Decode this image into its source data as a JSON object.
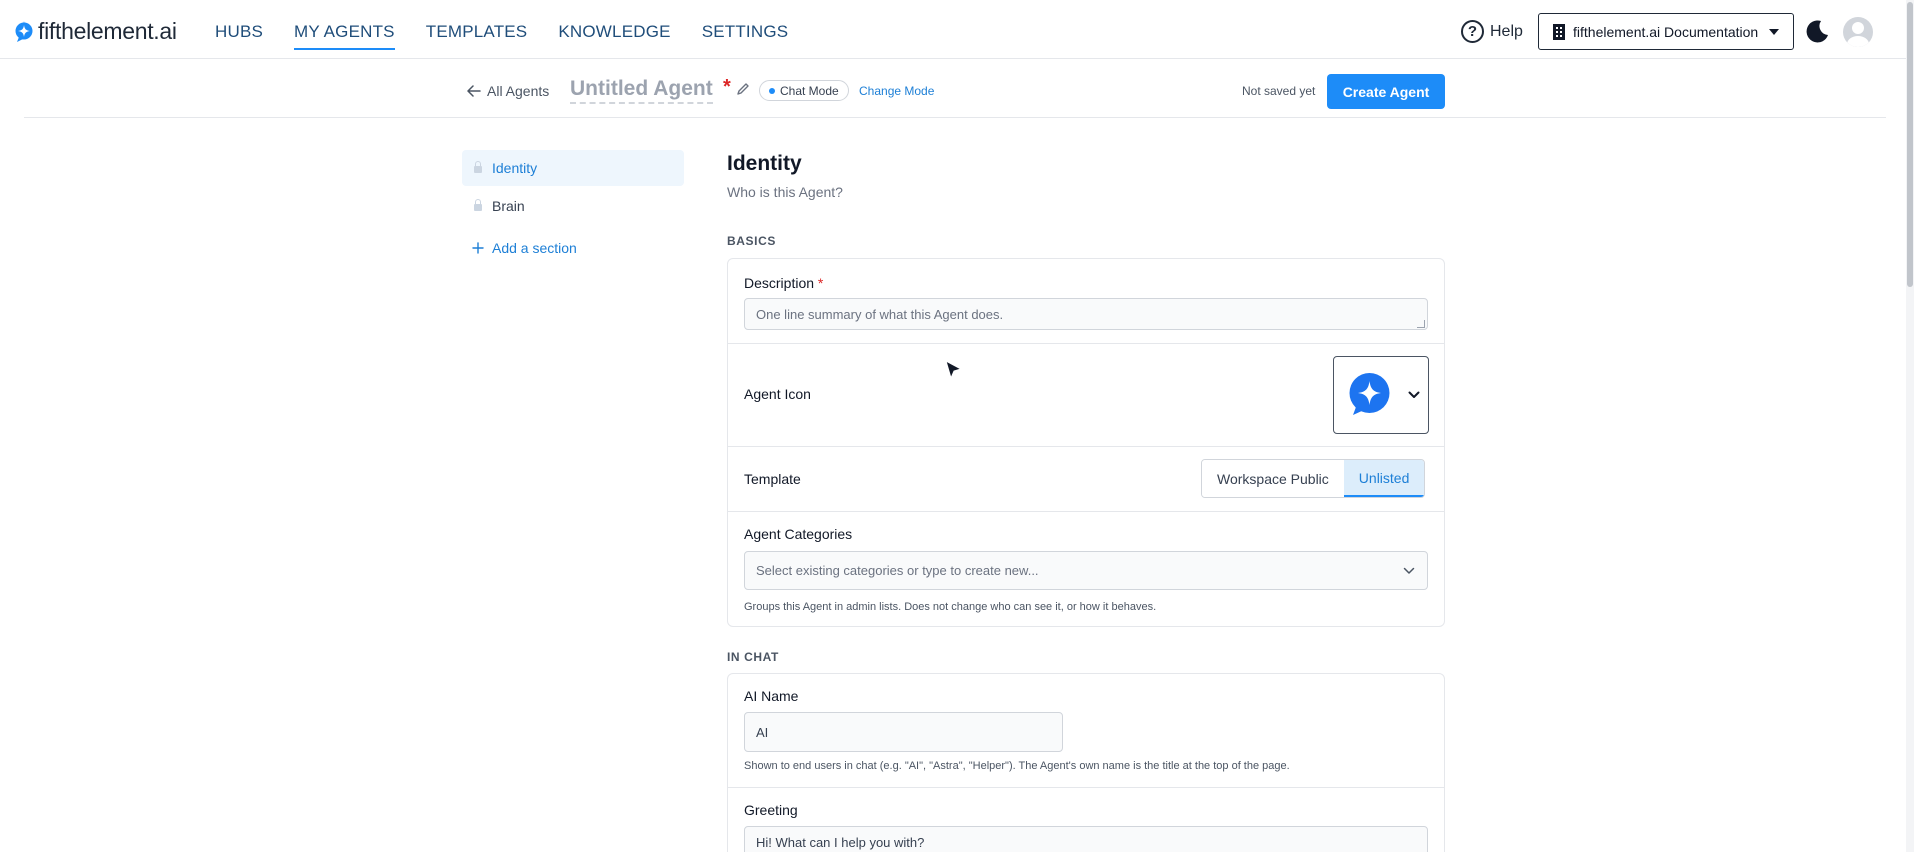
{
  "brand": {
    "name": "fifthelement.ai"
  },
  "nav": {
    "links": [
      {
        "label": "HUBS"
      },
      {
        "label": "MY AGENTS"
      },
      {
        "label": "TEMPLATES"
      },
      {
        "label": "KNOWLEDGE"
      },
      {
        "label": "SETTINGS"
      }
    ],
    "active": "MY AGENTS",
    "help_label": "Help",
    "workspace_label": "fifthelement.ai Documentation"
  },
  "agent_bar": {
    "back_label": "All Agents",
    "title": "Untitled Agent",
    "required_marker": "*",
    "mode_label": "Chat Mode",
    "change_mode_label": "Change Mode",
    "save_status": "Not saved yet",
    "create_label": "Create Agent"
  },
  "sidebar": {
    "items": [
      {
        "label": "Identity",
        "active": true
      },
      {
        "label": "Brain",
        "active": false
      }
    ],
    "add_section_label": "Add a section"
  },
  "identity": {
    "heading": "Identity",
    "subheading": "Who is this Agent?"
  },
  "basics": {
    "section_label": "BASICS",
    "description": {
      "label": "Description",
      "required": "*",
      "placeholder": "One line summary of what this Agent does.",
      "value": ""
    },
    "agent_icon": {
      "label": "Agent Icon"
    },
    "template": {
      "label": "Template",
      "options": [
        "Workspace Public",
        "Unlisted"
      ],
      "selected": "Unlisted"
    },
    "categories": {
      "label": "Agent Categories",
      "placeholder": "Select existing categories or type to create new...",
      "hint": "Groups this Agent in admin lists. Does not change who can see it, or how it behaves."
    }
  },
  "in_chat": {
    "section_label": "IN CHAT",
    "ai_name": {
      "label": "AI Name",
      "value": "AI",
      "hint": "Shown to end users in chat (e.g. \"AI\", \"Astra\", \"Helper\"). The Agent's own name is the title at the top of the page."
    },
    "greeting": {
      "label": "Greeting",
      "value": "Hi! What can I help you with?"
    }
  },
  "colors": {
    "accent": "#1d8cf8",
    "link": "#1d7fd6",
    "required": "#dc2626",
    "nav_text": "#1f4d7a"
  }
}
